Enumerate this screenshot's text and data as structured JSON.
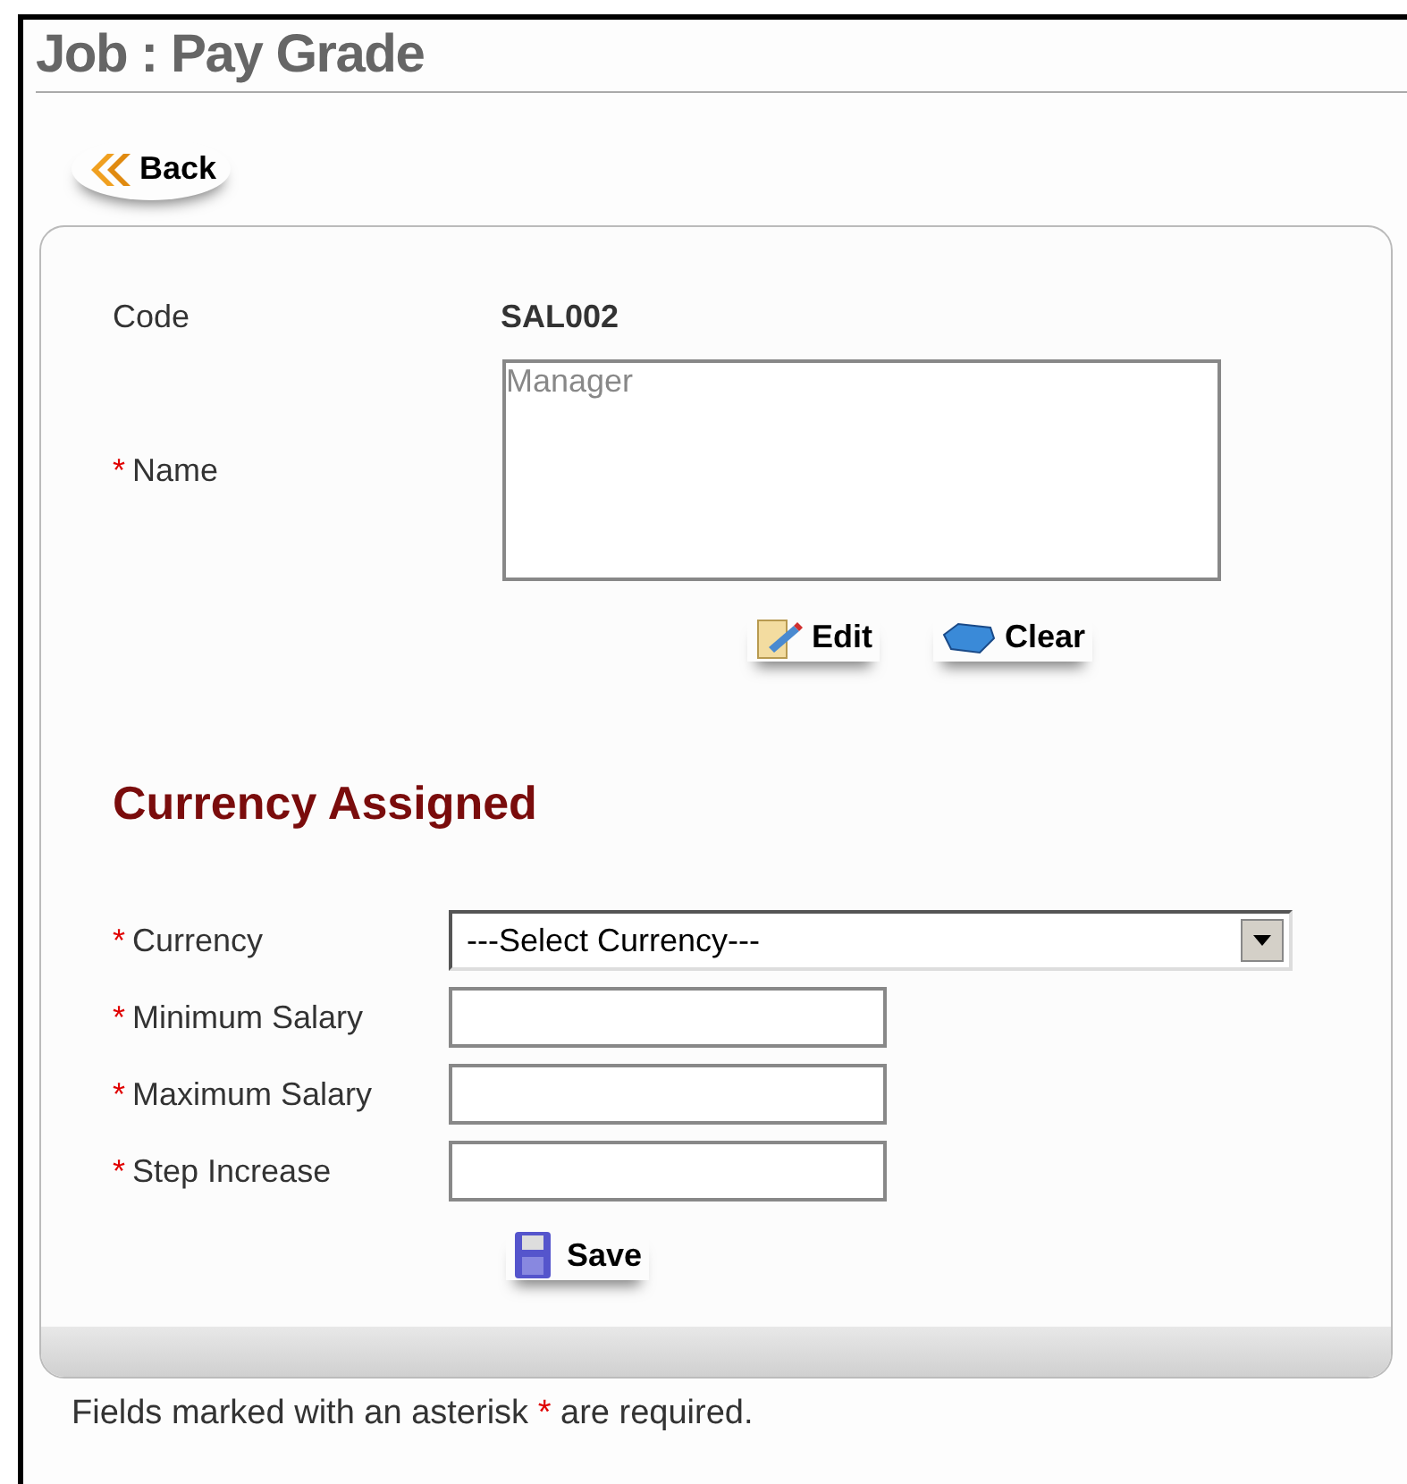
{
  "title": "Job : Pay Grade",
  "back_button": "Back",
  "code": {
    "label": "Code",
    "value": "SAL002"
  },
  "name": {
    "mark": "*",
    "label": "Name",
    "value": "Manager"
  },
  "name_actions": [
    {
      "kind": "edit",
      "label": "Edit"
    },
    {
      "kind": "clear",
      "label": "Clear"
    }
  ],
  "section_title": "Currency Assigned",
  "fields": [
    {
      "kind": "select",
      "mark": "*",
      "label": "Currency",
      "value": "---Select Currency---"
    },
    {
      "kind": "input",
      "mark": "*",
      "label": "Minimum Salary"
    },
    {
      "kind": "input",
      "mark": "*",
      "label": "Maximum Salary"
    },
    {
      "kind": "input",
      "mark": "*",
      "label": "Step Increase"
    }
  ],
  "save_button": "Save",
  "footnote": {
    "before": "Fields marked with an asterisk",
    "mark": "*",
    "after": "are required."
  }
}
